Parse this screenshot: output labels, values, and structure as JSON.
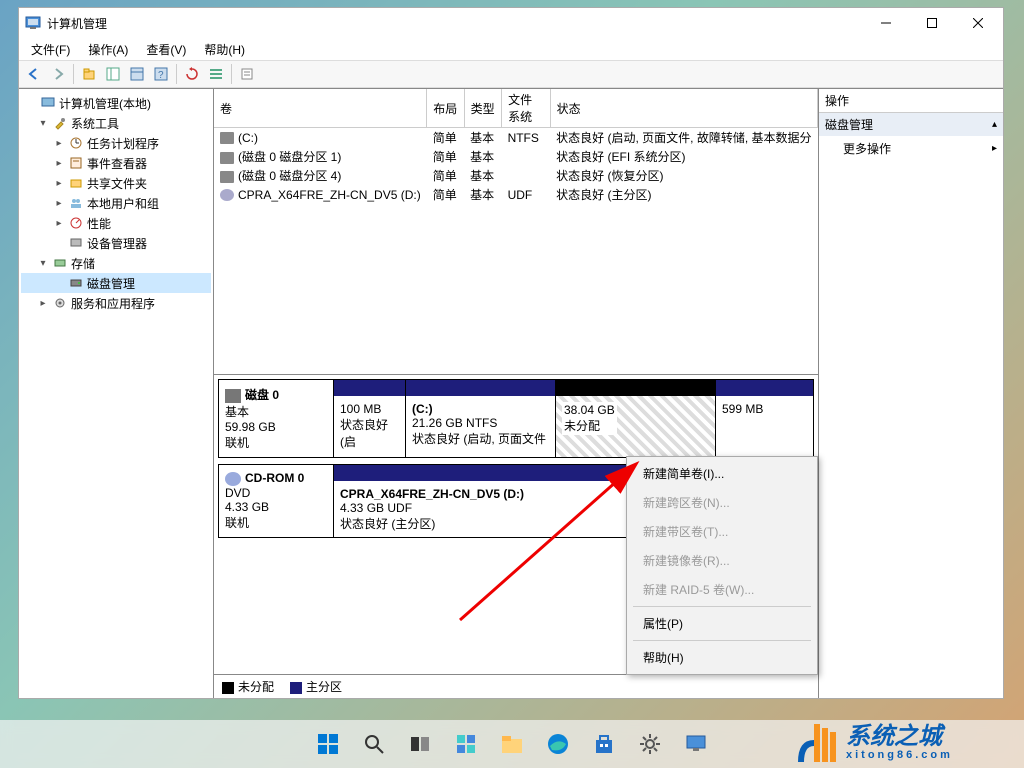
{
  "window": {
    "title": "计算机管理"
  },
  "menu": {
    "file": "文件(F)",
    "action": "操作(A)",
    "view": "查看(V)",
    "help": "帮助(H)"
  },
  "tree": {
    "root": "计算机管理(本地)",
    "systools": "系统工具",
    "task": "任务计划程序",
    "eventviewer": "事件查看器",
    "shared": "共享文件夹",
    "users": "本地用户和组",
    "perf": "性能",
    "devmgr": "设备管理器",
    "storage": "存储",
    "diskmgmt": "磁盘管理",
    "services": "服务和应用程序"
  },
  "grid": {
    "cols": {
      "volume": "卷",
      "layout": "布局",
      "type": "类型",
      "fs": "文件系统",
      "status": "状态"
    },
    "rows": [
      {
        "vol": "(C:)",
        "layout": "简单",
        "type": "基本",
        "fs": "NTFS",
        "status": "状态良好 (启动, 页面文件, 故障转储, 基本数据分"
      },
      {
        "vol": "(磁盘 0 磁盘分区 1)",
        "layout": "简单",
        "type": "基本",
        "fs": "",
        "status": "状态良好 (EFI 系统分区)"
      },
      {
        "vol": "(磁盘 0 磁盘分区 4)",
        "layout": "简单",
        "type": "基本",
        "fs": "",
        "status": "状态良好 (恢复分区)"
      },
      {
        "vol": "CPRA_X64FRE_ZH-CN_DV5 (D:)",
        "layout": "简单",
        "type": "基本",
        "fs": "UDF",
        "status": "状态良好 (主分区)"
      }
    ]
  },
  "disks": {
    "d0": {
      "name": "磁盘 0",
      "type": "基本",
      "size": "59.98 GB",
      "status": "联机",
      "parts": [
        {
          "title": "",
          "line2": "100 MB",
          "line3": "状态良好 (启"
        },
        {
          "title": "(C:)",
          "line2": "21.26 GB NTFS",
          "line3": "状态良好 (启动, 页面文件"
        },
        {
          "title": "",
          "line2": "38.04 GB",
          "line3": "未分配"
        },
        {
          "title": "",
          "line2": "599 MB",
          "line3": ""
        }
      ]
    },
    "d1": {
      "name": "CD-ROM 0",
      "type": "DVD",
      "size": "4.33 GB",
      "status": "联机",
      "part": {
        "title": "CPRA_X64FRE_ZH-CN_DV5 (D:)",
        "line2": "4.33 GB UDF",
        "line3": "状态良好 (主分区)"
      }
    }
  },
  "legend": {
    "unalloc": "未分配",
    "primary": "主分区"
  },
  "actions": {
    "header": "操作",
    "diskmgmt": "磁盘管理",
    "more": "更多操作"
  },
  "context": {
    "new_simple": "新建简单卷(I)...",
    "new_span": "新建跨区卷(N)...",
    "new_stripe": "新建带区卷(T)...",
    "new_mirror": "新建镜像卷(R)...",
    "new_raid5": "新建 RAID-5 卷(W)...",
    "properties": "属性(P)",
    "help": "帮助(H)"
  },
  "watermark": {
    "big": "系统之城",
    "url": "xitong86.com"
  },
  "chart_data": {
    "type": "table",
    "title": "磁盘管理卷列表",
    "columns": [
      "卷",
      "布局",
      "类型",
      "文件系统",
      "状态"
    ],
    "rows": [
      [
        "(C:)",
        "简单",
        "基本",
        "NTFS",
        "状态良好 (启动, 页面文件, 故障转储, 基本数据分区)"
      ],
      [
        "(磁盘 0 磁盘分区 1)",
        "简单",
        "基本",
        "",
        "状态良好 (EFI 系统分区)"
      ],
      [
        "(磁盘 0 磁盘分区 4)",
        "简单",
        "基本",
        "",
        "状态良好 (恢复分区)"
      ],
      [
        "CPRA_X64FRE_ZH-CN_DV5 (D:)",
        "简单",
        "基本",
        "UDF",
        "状态良好 (主分区)"
      ]
    ],
    "disks": [
      {
        "name": "磁盘 0",
        "type": "基本",
        "size_gb": 59.98,
        "status": "联机",
        "partitions": [
          {
            "label": "",
            "size_mb": 100,
            "fs": "",
            "status": "状态良好"
          },
          {
            "label": "(C:)",
            "size_gb": 21.26,
            "fs": "NTFS",
            "status": "状态良好 (启动, 页面文件)"
          },
          {
            "label": "",
            "size_gb": 38.04,
            "fs": "",
            "status": "未分配"
          },
          {
            "label": "",
            "size_mb": 599,
            "fs": "",
            "status": ""
          }
        ]
      },
      {
        "name": "CD-ROM 0",
        "type": "DVD",
        "size_gb": 4.33,
        "status": "联机",
        "partitions": [
          {
            "label": "CPRA_X64FRE_ZH-CN_DV5 (D:)",
            "size_gb": 4.33,
            "fs": "UDF",
            "status": "状态良好 (主分区)"
          }
        ]
      }
    ]
  }
}
